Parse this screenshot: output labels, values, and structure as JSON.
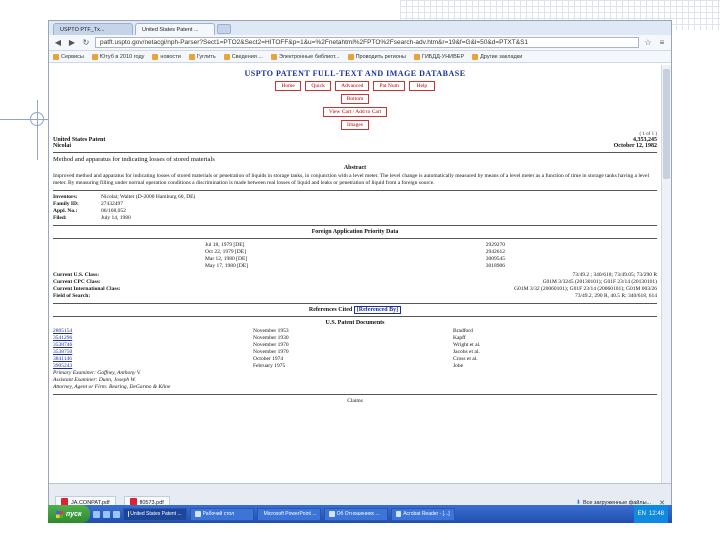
{
  "browser": {
    "tabs": [
      {
        "label": "USPTO PTF_Tx..."
      },
      {
        "label": "United States Patent ..."
      }
    ],
    "url": "patft.uspto.gov/netacgi/nph-Parser?Sect1=PTO2&Sect2=HITOFF&p=1&u=%2Fnetahtml%2FPTO%2Fsearch-adv.htm&r=19&f=G&l=50&d=PTXT&S1",
    "bookmarks": [
      "Сервисы",
      "Ютуб в 2010 году",
      "новости",
      "Гуглить",
      "Сведения ...",
      "Электронные библиот...",
      "Проводить регионы",
      "ГИБДД-УНИВЕР",
      "Другие закладки"
    ]
  },
  "page": {
    "header": "USPTO PATENT FULL-TEXT AND IMAGE DATABASE",
    "nav_buttons_row1": [
      "Home",
      "Quick",
      "Advanced",
      "Pat Num",
      "Help"
    ],
    "nav_buttons_row2": [
      "Bottom"
    ],
    "nav_buttons_row3": [
      "View Cart / Add to Cart"
    ],
    "nav_buttons_row4": [
      "Images"
    ],
    "hit_count": "( 1 of 1 )",
    "patent_label": "United States Patent",
    "patent_number": "4,353,245",
    "inventor_short": "Nicolai",
    "date": "October 12, 1982",
    "title": "Method and apparatus for indicating losses of stored materials",
    "abstract_heading": "Abstract",
    "abstract": "Improved method and apparatus for indicating losses of stored materials or penetration of liquids in storage tanks, in conjunction with a level meter. The level change is automatically measured by means of a level meter as a function of time in storage tanks having a level meter. By measuring filling under normal operation conditions a discrimination is made between real losses of liquid and leaks or penetration of liquid from a foreign source.",
    "details": [
      {
        "k": "Inventors:",
        "v": "Nicolai; Walter (D-2000 Hamburg 60, DE)"
      },
      {
        "k": "Family ID:",
        "v": "27432497"
      },
      {
        "k": "Appl. No.:",
        "v": "06/168,052"
      },
      {
        "k": "Filed:",
        "v": "July 14, 1980"
      }
    ],
    "foreign_heading": "Foreign Application Priority Data",
    "foreign": [
      {
        "date": "Jul 18, 1979 [DE]",
        "num": "2929270"
      },
      {
        "date": "Oct 22, 1979 [DE]",
        "num": "2942612"
      },
      {
        "date": "Mar 12, 1980 [DE]",
        "num": "3009545"
      },
      {
        "date": "May 17, 1980 [DE]",
        "num": "3018906"
      }
    ],
    "classes": [
      {
        "k": "Current U.S. Class:",
        "v": "73/49.2 ; 340/618; 73/49.05; 73/290 R"
      },
      {
        "k": "Current CPC Class:",
        "v": "G01M 3/3245 (20130101); G01F 23/14 (20130101)"
      },
      {
        "k": "Current International Class:",
        "v": "G01M 3/32 (20060101); G01F 23/14 (20060101); G01M 003/26"
      },
      {
        "k": "Field of Search:",
        "v": "73/49.2, 290 R, 40.5 R; 340/618, 614"
      }
    ],
    "refs_heading": "References Cited",
    "refs_button": "[Referenced By]",
    "us_docs_heading": "U.S. Patent Documents",
    "refs": [
      {
        "num": "2805154",
        "date": "November 1953",
        "name": "Bradford"
      },
      {
        "num": "3541296",
        "date": "November 1930",
        "name": "Kapff"
      },
      {
        "num": "3538746",
        "date": "November 1970",
        "name": "Wright et al."
      },
      {
        "num": "3538750",
        "date": "November 1970",
        "name": "Jacobs et al."
      },
      {
        "num": "3841146",
        "date": "October 1974",
        "name": "Cross et al."
      },
      {
        "num": "3905243",
        "date": "February 1975",
        "name": "Jobe"
      }
    ],
    "examiner": [
      "Primary Examiner: Gaffney, Anthony V.",
      "Assistant Examiner: Dunn, Joseph W.",
      "Attorney, Agent or Firm: Bearing, DeGarmo & Kline"
    ],
    "claims_label": "Claims"
  },
  "downloads": {
    "items": [
      "JA.CONPAT.pdf",
      "fl0573.pdf"
    ],
    "show_all": "Все загруженные файлы..."
  },
  "taskbar": {
    "start": "пуск",
    "tasks": [
      "United States Patent ...",
      "Рабочий стол",
      "Microsoft PowerPoint ...",
      "Об Отношениях ...",
      "Acrobat Reader - [...]"
    ],
    "lang": "EN",
    "clock": "12:48"
  },
  "colors": {
    "link": "#1a2f9c",
    "nav_button": "#b00000",
    "taskbar": "#1f4fb0",
    "start": "#2e8a2e"
  }
}
